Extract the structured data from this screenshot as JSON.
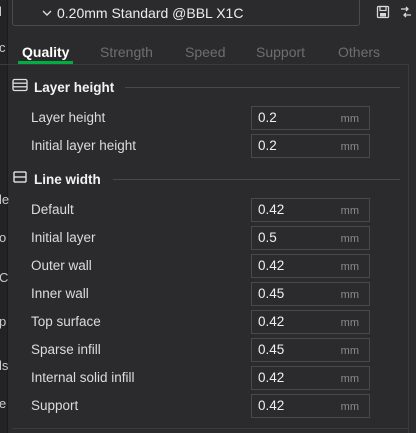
{
  "preset": {
    "name": "0.20mm Standard @BBL X1C"
  },
  "left_strip": [
    "l",
    "c",
    "le",
    "o",
    "C",
    "p",
    "ls",
    "e"
  ],
  "tabs": [
    {
      "label": "Quality",
      "active": true
    },
    {
      "label": "Strength",
      "active": false
    },
    {
      "label": "Speed",
      "active": false
    },
    {
      "label": "Support",
      "active": false
    },
    {
      "label": "Others",
      "active": false
    }
  ],
  "sections": {
    "layer_height": {
      "title": "Layer height",
      "rows": [
        {
          "label": "Layer height",
          "value": "0.2",
          "unit": "mm"
        },
        {
          "label": "Initial layer height",
          "value": "0.2",
          "unit": "mm"
        }
      ]
    },
    "line_width": {
      "title": "Line width",
      "rows": [
        {
          "label": "Default",
          "value": "0.42",
          "unit": "mm"
        },
        {
          "label": "Initial layer",
          "value": "0.5",
          "unit": "mm"
        },
        {
          "label": "Outer wall",
          "value": "0.42",
          "unit": "mm"
        },
        {
          "label": "Inner wall",
          "value": "0.45",
          "unit": "mm"
        },
        {
          "label": "Top surface",
          "value": "0.42",
          "unit": "mm"
        },
        {
          "label": "Sparse infill",
          "value": "0.45",
          "unit": "mm"
        },
        {
          "label": "Internal solid infill",
          "value": "0.42",
          "unit": "mm"
        },
        {
          "label": "Support",
          "value": "0.42",
          "unit": "mm"
        }
      ]
    }
  },
  "colors": {
    "accent": "#00ae42",
    "background": "#2b2b2d"
  },
  "icons": {
    "preset_dropdown": "chevron-down-icon",
    "save": "save-icon",
    "compare": "compare-icon",
    "layer_section": "layers-icon",
    "line_width_section": "line-width-icon"
  }
}
